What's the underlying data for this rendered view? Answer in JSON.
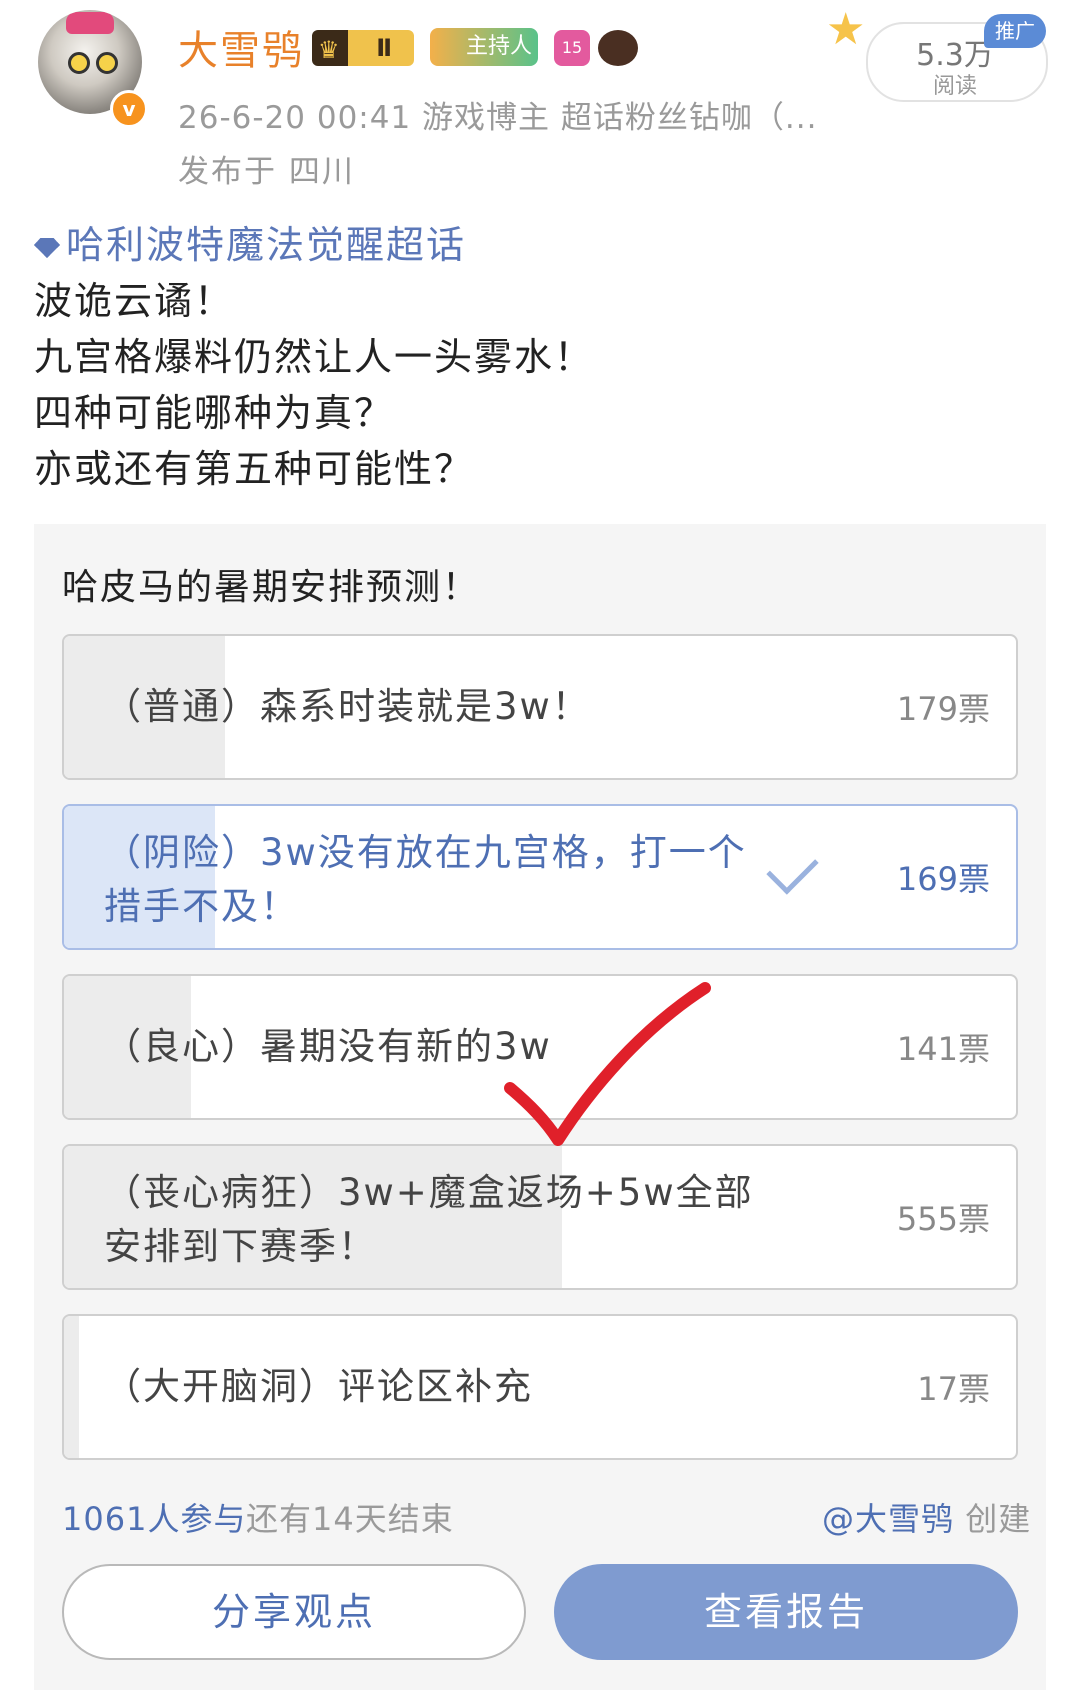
{
  "author": {
    "name": "大雪鸮",
    "badges": {
      "level": "Ⅱ",
      "host": "主持人",
      "gem": "15"
    },
    "meta": "26-6-20 00:41  游戏博主 超话粉丝钻咖（...",
    "location": "发布于 四川"
  },
  "stats": {
    "reads": "5.3万",
    "reads_label": "阅读",
    "promo": "推广"
  },
  "post": {
    "topic": "哈利波特魔法觉醒超话",
    "lines": [
      "波诡云谲！",
      "九宫格爆料仍然让人一头雾水！",
      "四种可能哪种为真？",
      "亦或还有第五种可能性？"
    ]
  },
  "poll": {
    "title": "哈皮马的暑期安排预测！",
    "options": [
      {
        "line1": "（普通）森系时装就是3w！",
        "line2": "",
        "votes": "179票",
        "share": 0.169,
        "selected": false
      },
      {
        "line1": "（阴险）3w没有放在九宫格，打一个",
        "line2": "措手不及！",
        "votes": "169票",
        "share": 0.159,
        "selected": true
      },
      {
        "line1": "（良心）暑期没有新的3w",
        "line2": "",
        "votes": "141票",
        "share": 0.133,
        "selected": false
      },
      {
        "line1": "（丧心病狂）3w+魔盒返场+5w全部",
        "line2": "安排到下赛季！",
        "votes": "555票",
        "share": 0.523,
        "selected": false
      },
      {
        "line1": "（大开脑洞）评论区补充",
        "line2": "",
        "votes": "17票",
        "share": 0.016,
        "selected": false
      }
    ],
    "participants": "1061人参与",
    "remaining": "还有14天结束",
    "creator": "@大雪鸮",
    "creator_suffix": " 创建",
    "share_button": "分享观点",
    "report_button": "查看报告"
  },
  "icons": {
    "verified": "verified-badge-icon",
    "check": "check-icon",
    "annotation": "red-check-annotation"
  },
  "colors": {
    "username": "#e8812a",
    "link": "#4e6fb3",
    "report_button": "#7f9bd0",
    "annotation": "#e0202a"
  }
}
